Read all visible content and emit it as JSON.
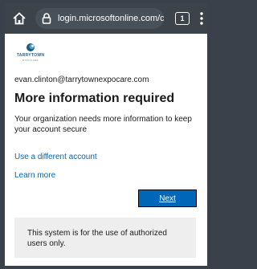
{
  "browser": {
    "url": "login.microsoftonline.com/c",
    "tab_count": "1",
    "icons": [
      "home-icon",
      "lock-icon",
      "tabs-icon",
      "menu-icon"
    ]
  },
  "brand": {
    "name": "TARRYTOWN",
    "tagline": "EXPOCARE"
  },
  "account": {
    "email": "evan.clinton@tarrytownexpocare.com"
  },
  "page": {
    "title": "More information required",
    "description": "Your organization needs more information to keep your account secure"
  },
  "links": {
    "different_account": "Use a different account",
    "learn_more": "Learn more"
  },
  "actions": {
    "next_label": "Next"
  },
  "notice": {
    "text": "This system is for the use of authorized users only."
  },
  "colors": {
    "accent": "#0067b8",
    "browser_bg": "#3d434b",
    "notice_bg": "#eeeeee"
  }
}
